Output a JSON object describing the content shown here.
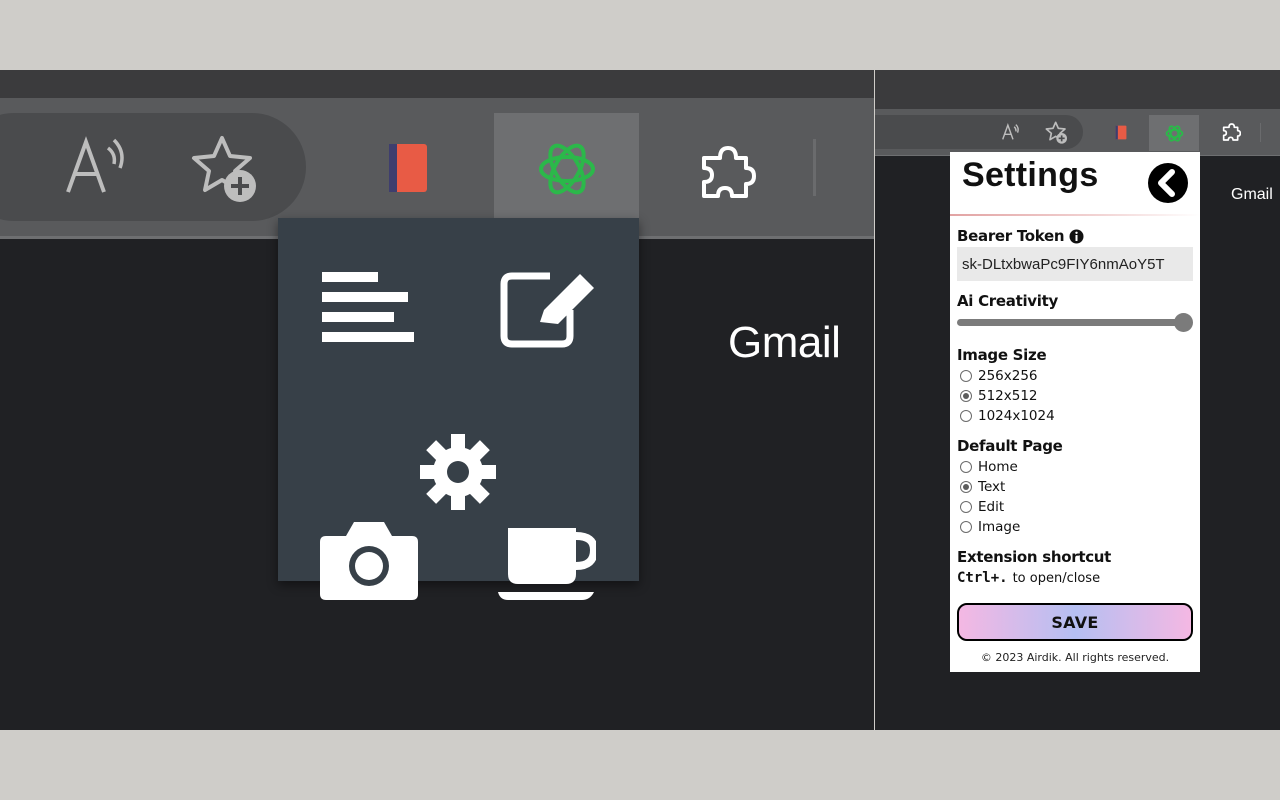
{
  "left_view": {
    "gmail_label": "Gmail",
    "popup_menu": {
      "items": [
        {
          "icon": "text-lines-icon"
        },
        {
          "icon": "edit-pencil-icon"
        },
        {
          "icon": "gear-icon"
        },
        {
          "icon": "camera-icon"
        },
        {
          "icon": "coffee-cup-icon"
        }
      ]
    }
  },
  "right_view": {
    "gmail_label": "Gmail"
  },
  "settings": {
    "title": "Settings",
    "bearer_token": {
      "label": "Bearer Token",
      "value": "sk-DLtxbwaPc9FIY6nmAoY5T"
    },
    "ai_creativity": {
      "label": "Ai Creativity",
      "value": 1.0
    },
    "image_size": {
      "label": "Image Size",
      "options": [
        "256x256",
        "512x512",
        "1024x1024"
      ],
      "selected": "512x512"
    },
    "default_page": {
      "label": "Default Page",
      "options": [
        "Home",
        "Text",
        "Edit",
        "Image"
      ],
      "selected": "Text"
    },
    "shortcut": {
      "label": "Extension shortcut",
      "key": "Ctrl+.",
      "description": "to open/close"
    },
    "save_label": "SAVE",
    "copyright": "© 2023 Airdik. All rights reserved."
  },
  "colors": {
    "gpt_green": "#2bb84a",
    "red_extension": "#e85b45",
    "popup_bg": "#374048"
  }
}
